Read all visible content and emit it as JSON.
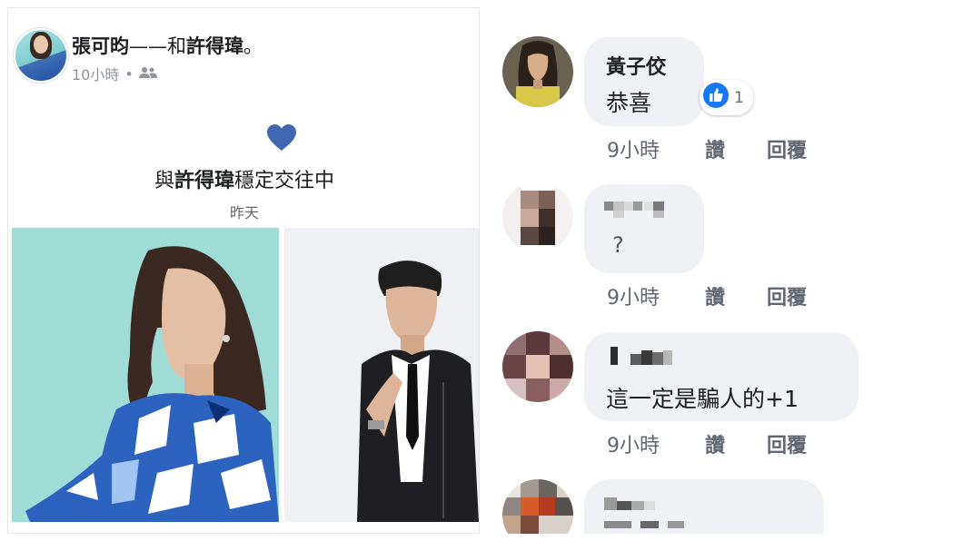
{
  "post": {
    "author": "張可昀",
    "connector": "——和",
    "tagged": "許得瑋",
    "title_end": "。",
    "time": "10小時",
    "dot": "•",
    "audience_icon": "friends-icon",
    "life_event": {
      "icon": "heart-icon",
      "prefix": "與",
      "name": "許得瑋",
      "suffix": "穩定交往中",
      "date": "昨天"
    }
  },
  "comments": [
    {
      "name": "黃子佼",
      "text": "恭喜",
      "reaction_icon": "like-reaction-icon",
      "reaction_count": "1",
      "time": "9小時",
      "like_label": "讚",
      "reply_label": "回覆"
    },
    {
      "name": "",
      "text": "?",
      "time": "9小時",
      "like_label": "讚",
      "reply_label": "回覆"
    },
    {
      "name": "",
      "text": "這一定是騙人的+1",
      "time": "9小時",
      "like_label": "讚",
      "reply_label": "回覆"
    },
    {
      "name": "",
      "text": ""
    }
  ],
  "colors": {
    "heart": "#4267b2",
    "like_blue": "#1877f2",
    "bubble": "#eff1f4",
    "meta_gray": "#90949c"
  }
}
